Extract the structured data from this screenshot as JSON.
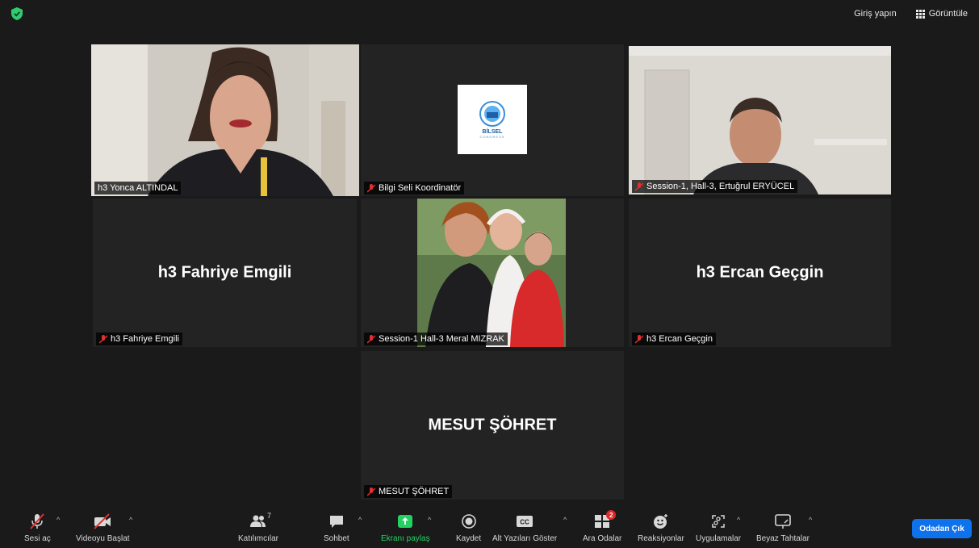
{
  "topbar": {
    "signin_label": "Giriş yapın",
    "view_label": "Görüntüle",
    "shield_color": "#2ecc71"
  },
  "tiles": {
    "t1": {
      "name": "h3 Yonca ALTINDAL",
      "muted": false,
      "active": true,
      "content": "video"
    },
    "t2": {
      "name": "Bilgi Seli Koordinatör",
      "muted": true,
      "content": "logo",
      "logo_text": "BİLSEL",
      "logo_sub": "CONGRESS"
    },
    "t3": {
      "name": "Session-1, Hall-3, Ertuğrul ERYÜCEL",
      "muted": true,
      "content": "video"
    },
    "t4": {
      "name": "h3 Fahriye Emgili",
      "display_name": "h3 Fahriye Emgili",
      "muted": true,
      "content": "name"
    },
    "t5": {
      "name": "Session-1 Hall-3 Meral MIZRAK",
      "muted": true,
      "content": "photo"
    },
    "t6": {
      "name": "h3 Ercan Geçgin",
      "display_name": "h3 Ercan Geçgin",
      "muted": true,
      "content": "name"
    },
    "t7": {
      "name": "MESUT ŞÖHRET",
      "display_name": "MESUT ŞÖHRET",
      "muted": true,
      "content": "name"
    }
  },
  "toolbar": {
    "audio_label": "Sesi aç",
    "video_label": "Videoyu Başlat",
    "participants_label": "Katılımcılar",
    "participants_count": "7",
    "chat_label": "Sohbet",
    "share_label": "Ekranı paylaş",
    "record_label": "Kaydet",
    "captions_label": "Alt Yazıları Göster",
    "breakout_label": "Ara Odalar",
    "breakout_badge": "2",
    "reactions_label": "Reaksiyonlar",
    "apps_label": "Uygulamalar",
    "whiteboard_label": "Beyaz Tahtalar",
    "leave_label": "Odadan Çık",
    "share_color": "#23d160",
    "leave_color": "#0e72ed"
  }
}
